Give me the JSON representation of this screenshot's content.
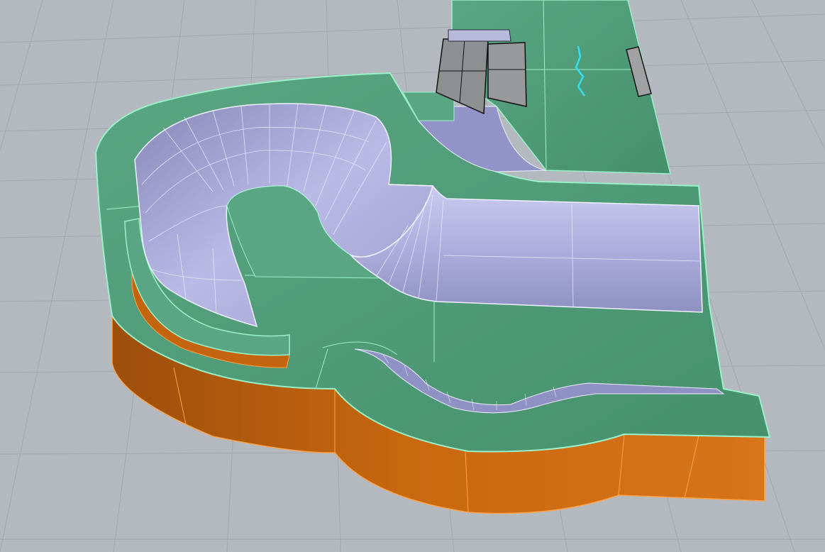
{
  "viewport": {
    "kind": "3d-perspective-viewport",
    "display_mode": "shaded-with-edges",
    "visible_text": []
  },
  "colors": {
    "background": "#b4b9bf",
    "grid_line": "#a2a7ad",
    "deck_green": "#4f9a76",
    "deck_edge": "#9af0c8",
    "bowl_lavender": "#a9a9d8",
    "bowl_wire": "#eeeeff",
    "wall_orange": "#d26f14",
    "wall_edge": "#ffa34a",
    "obstacle_gray": "#8d8e90",
    "curve_cyan": "#33e0f0"
  },
  "scene_objects": [
    {
      "name": "deck-surface",
      "material": "green"
    },
    {
      "name": "bowl",
      "material": "lavender"
    },
    {
      "name": "quarterpipe-channel",
      "material": "lavender"
    },
    {
      "name": "lower-transition",
      "material": "lavender"
    },
    {
      "name": "outer-wall",
      "material": "orange"
    },
    {
      "name": "inner-ledge",
      "material": "orange"
    },
    {
      "name": "box-obstacle-left",
      "material": "gray"
    },
    {
      "name": "box-obstacle-right",
      "material": "gray"
    },
    {
      "name": "rail-obstacle",
      "material": "gray"
    },
    {
      "name": "control-curve",
      "material": "cyan"
    }
  ]
}
